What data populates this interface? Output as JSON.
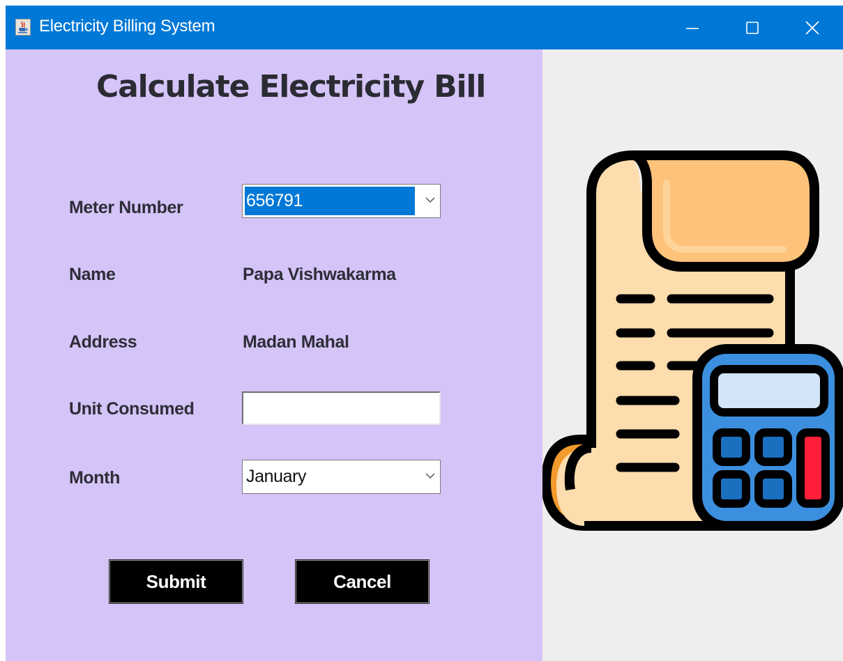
{
  "window": {
    "title": "Electricity Billing System",
    "app_icon": "java-cup-icon",
    "controls": [
      "minimize-icon",
      "maximize-icon",
      "close-icon"
    ],
    "titlebar_color": "#0078d7"
  },
  "form": {
    "heading": "Calculate Electricity Bill",
    "panel_color": "#d5c4f7",
    "meter_label": "Meter Number",
    "meter_value": "656791",
    "name_label": "Name",
    "name_value": "Papa Vishwakarma",
    "address_label": "Address",
    "address_value": "Madan Mahal",
    "units_label": "Unit Consumed",
    "units_value": "",
    "month_label": "Month",
    "month_value": "January",
    "submit_label": "Submit",
    "cancel_label": "Cancel"
  },
  "illustration": {
    "icon": "bill-calculator-icon"
  }
}
